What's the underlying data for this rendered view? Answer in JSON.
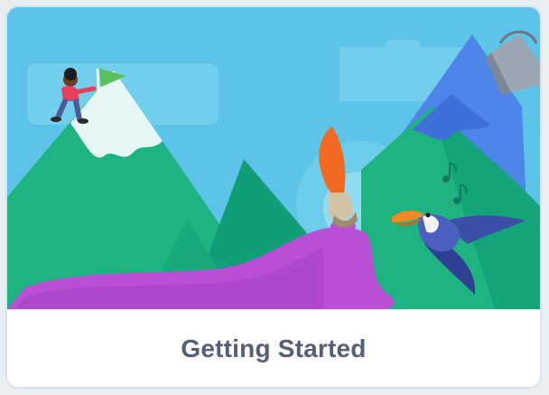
{
  "card": {
    "title": "Getting Started"
  },
  "illustration": {
    "icons": [
      "person-with-flag-icon",
      "flag-icon",
      "paint-bucket-icon",
      "paintbrush-icon",
      "toucan-bird-icon",
      "music-notes-icon"
    ]
  },
  "colors": {
    "sky": "#5bc4e8",
    "mountain_green": "#1fb381",
    "mountain_dark": "#109e78",
    "mountain_blue": "#4d86e8",
    "paint_purple": "#b94fd4",
    "snow": "#e6f6f5",
    "caption_text": "#575e75",
    "card_border": "#d9e1ea"
  }
}
